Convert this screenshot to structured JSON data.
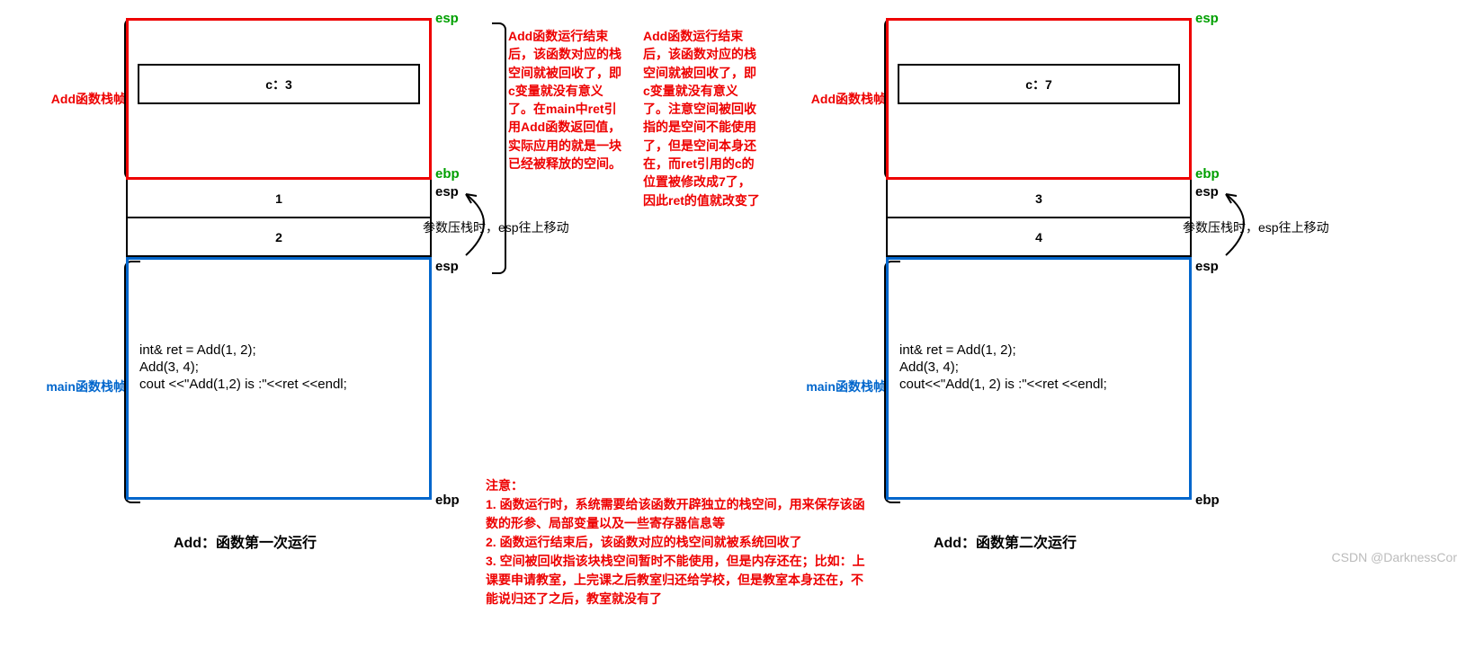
{
  "left": {
    "addFrameLabel": "Add函数栈帧",
    "mainFrameLabel": "main函数栈帧",
    "cVal": "c：3",
    "arg1": "1",
    "arg2": "2",
    "code": {
      "l1": "int& ret = Add(1, 2);",
      "l2": "Add(3, 4);",
      "l3": "cout <<\"Add(1,2) is :\"<<ret <<endl;"
    },
    "esp": "esp",
    "ebp": "ebp",
    "pushNote": "参数压栈时，esp往上移动",
    "caption": "Add：函数第一次运行"
  },
  "mid1": "Add函数运行结束后，该函数对应的栈空间就被回收了，即c变量就没有意义了。在main中ret引用Add函数返回值，实际应用的就是一块已经被释放的空间。",
  "mid2": "Add函数运行结束后，该函数对应的栈空间就被回收了，即c变量就没有意义了。注意空间被回收指的是空间不能使用了，但是空间本身还在，而ret引用的c的位置被修改成7了，因此ret的值就改变了",
  "right": {
    "addFrameLabel": "Add函数栈帧",
    "mainFrameLabel": "main函数栈帧",
    "cVal": "c：7",
    "arg1": "3",
    "arg2": "4",
    "code": {
      "l1": "int& ret = Add(1, 2);",
      "l2": "Add(3, 4);",
      "l3": "cout<<\"Add(1, 2) is :\"<<ret <<endl;"
    },
    "esp": "esp",
    "ebp": "ebp",
    "pushNote": "参数压栈时，esp往上移动",
    "caption": "Add：函数第二次运行"
  },
  "notes": {
    "title": "注意：",
    "n1": "1. 函数运行时，系统需要给该函数开辟独立的栈空间，用来保存该函数的形参、局部变量以及一些寄存器信息等",
    "n2": "2. 函数运行结束后，该函数对应的栈空间就被系统回收了",
    "n3": "3. 空间被回收指该块栈空间暂时不能使用，但是内存还在；比如：上课要申请教室，上完课之后教室归还给学校，但是教室本身还在，不能说归还了之后，教室就没有了"
  },
  "watermark": "CSDN @DarknessCor"
}
